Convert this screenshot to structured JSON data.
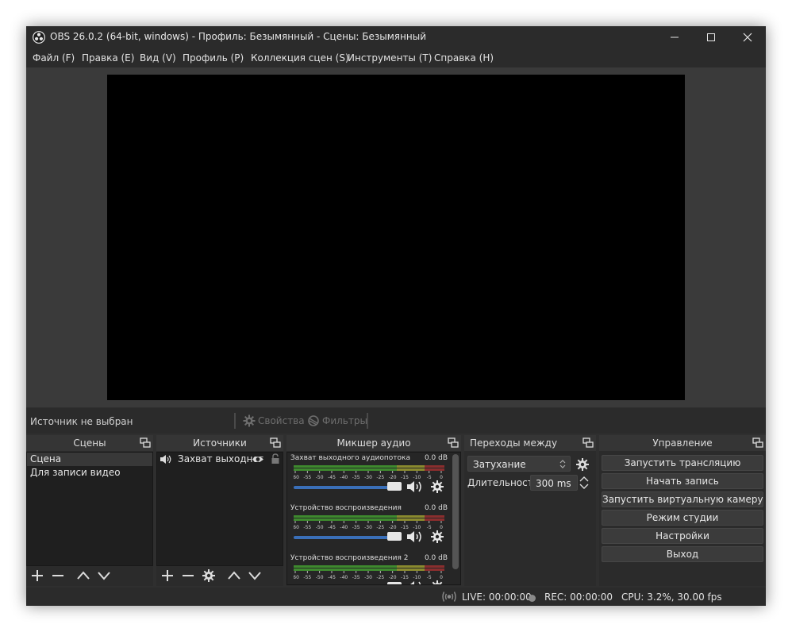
{
  "window": {
    "title": "OBS 26.0.2 (64-bit, windows) - Профиль: Безымянный - Сцены: Безымянный"
  },
  "menu": [
    "Файл (F)",
    "Правка (E)",
    "Вид (V)",
    "Профиль (P)",
    "Коллекция сцен (S)",
    "Инструменты (T)",
    "Справка (H)"
  ],
  "source_toolbar": {
    "status": "Источник не выбран",
    "properties_label": "Свойства",
    "filters_label": "Фильтры"
  },
  "docks": {
    "scenes": {
      "title": "Сцены",
      "items": [
        "Сцена",
        "Для записи видео"
      ]
    },
    "sources": {
      "title": "Источники",
      "items": [
        "Захват выходног"
      ]
    },
    "mixer": {
      "title": "Микшер аудио",
      "channels": [
        {
          "name": "Захват выходного аудиопотока",
          "db": "0.0 dB"
        },
        {
          "name": "Устройство воспроизведения",
          "db": "0.0 dB"
        },
        {
          "name": "Устройство воспроизведения 2",
          "db": "0.0 dB"
        }
      ],
      "scale": [
        "-60",
        "-55",
        "-50",
        "-45",
        "-40",
        "-35",
        "-30",
        "-25",
        "-20",
        "-15",
        "-10",
        "-5",
        "0"
      ]
    },
    "transitions": {
      "title": "Переходы между сценами",
      "selected": "Затухание",
      "duration_label": "Длительность",
      "duration_value": "300 ms"
    },
    "controls": {
      "title": "Управление",
      "buttons": [
        "Запустить трансляцию",
        "Начать запись",
        "Запустить виртуальную камеру",
        "Режим студии",
        "Настройки",
        "Выход"
      ]
    }
  },
  "status": {
    "live": "LIVE: 00:00:00",
    "rec": "REC: 00:00:00",
    "cpu": "CPU: 3.2%, 30.00 fps"
  },
  "colors": {
    "background": "#2b2b2b",
    "meter_green": "#3e8a2e",
    "meter_yellow": "#8a8a2e",
    "meter_red": "#8a2e2e",
    "slider_blue": "#3a6fb8"
  }
}
